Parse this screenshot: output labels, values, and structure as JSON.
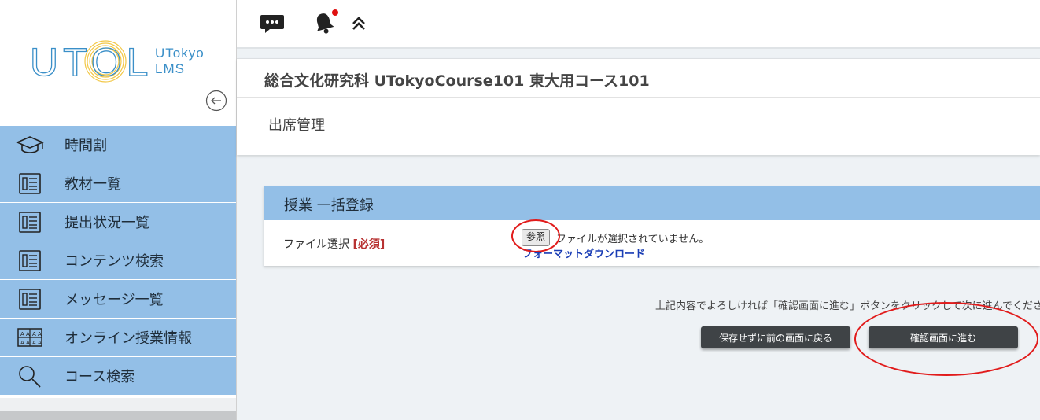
{
  "brand": {
    "logo_text": "UTOL",
    "sub_line1": "UTokyo",
    "sub_line2": "LMS"
  },
  "sidebar": {
    "items": [
      {
        "label": "時間割",
        "icon": "graduation-cap-icon"
      },
      {
        "label": "教材一覧",
        "icon": "document-list-icon"
      },
      {
        "label": "提出状況一覧",
        "icon": "document-list-icon"
      },
      {
        "label": "コンテンツ検索",
        "icon": "document-list-icon"
      },
      {
        "label": "メッセージ一覧",
        "icon": "document-list-icon"
      },
      {
        "label": "オンライン授業情報",
        "icon": "online-class-icon"
      },
      {
        "label": "コース検索",
        "icon": "search-icon"
      }
    ]
  },
  "topbar": {
    "notification_dot_color": "#e01010"
  },
  "header": {
    "course_title": "総合文化研究科 UTokyoCourse101 東大用コース101",
    "page_title": "出席管理"
  },
  "card": {
    "title": "授業 一括登録",
    "field_label": "ファイル選択",
    "required_tag": "[必須]",
    "browse_label": "参照",
    "no_file_text": "ファイルが選択されていません。",
    "format_link": "フォーマットダウンロード"
  },
  "instruction": "上記内容でよろしければ「確認画面に進む」ボタンをクリックして次に進んでくださ",
  "buttons": {
    "back_label": "保存せずに前の画面に戻る",
    "confirm_label": "確認画面に進む"
  },
  "colors": {
    "accent": "#93bfe7",
    "annotation": "#e11b1b",
    "button_dark": "#3f4346"
  }
}
